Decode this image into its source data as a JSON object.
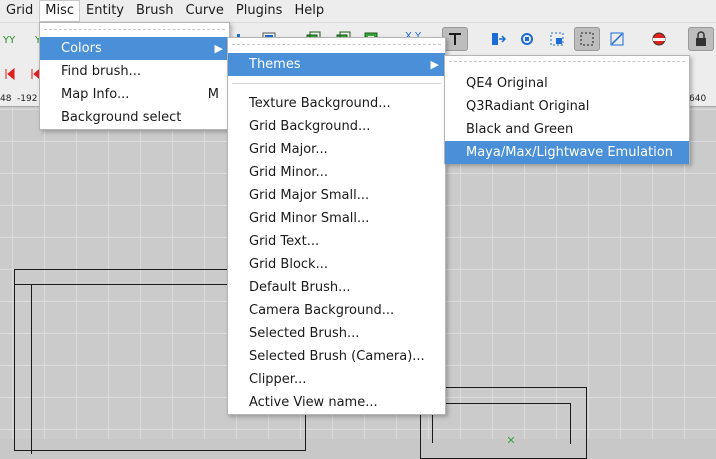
{
  "menubar": {
    "items": [
      {
        "label": "Grid"
      },
      {
        "label": "Misc"
      },
      {
        "label": "Entity"
      },
      {
        "label": "Brush"
      },
      {
        "label": "Curve"
      },
      {
        "label": "Plugins"
      },
      {
        "label": "Help"
      }
    ]
  },
  "toolbar": {
    "xy_label": "X Y"
  },
  "ruler": {
    "labels": [
      "48",
      "-192",
      "640"
    ]
  },
  "misc_menu": {
    "items": [
      {
        "label": "Colors",
        "accel": ""
      },
      {
        "label": "Find brush...",
        "accel": ""
      },
      {
        "label": "Map Info...",
        "accel": "M"
      },
      {
        "label": "Background select",
        "accel": ""
      }
    ]
  },
  "colors_menu": {
    "items": [
      {
        "label": "Themes"
      },
      {
        "label": "Texture Background..."
      },
      {
        "label": "Grid Background..."
      },
      {
        "label": "Grid Major..."
      },
      {
        "label": "Grid Minor..."
      },
      {
        "label": "Grid Major Small..."
      },
      {
        "label": "Grid Minor Small..."
      },
      {
        "label": "Grid Text..."
      },
      {
        "label": "Grid Block..."
      },
      {
        "label": "Default Brush..."
      },
      {
        "label": "Camera Background..."
      },
      {
        "label": "Selected Brush..."
      },
      {
        "label": "Selected Brush (Camera)..."
      },
      {
        "label": "Clipper..."
      },
      {
        "label": "Active View name..."
      }
    ]
  },
  "themes_menu": {
    "items": [
      {
        "label": "QE4 Original"
      },
      {
        "label": "Q3Radiant Original"
      },
      {
        "label": "Black and Green"
      },
      {
        "label": "Maya/Max/Lightwave Emulation"
      }
    ]
  },
  "colors": {
    "highlight": "#4a90d9",
    "icon_blue": "#1c6bd6",
    "icon_red": "#e0201c",
    "icon_green": "#3aa33a"
  }
}
